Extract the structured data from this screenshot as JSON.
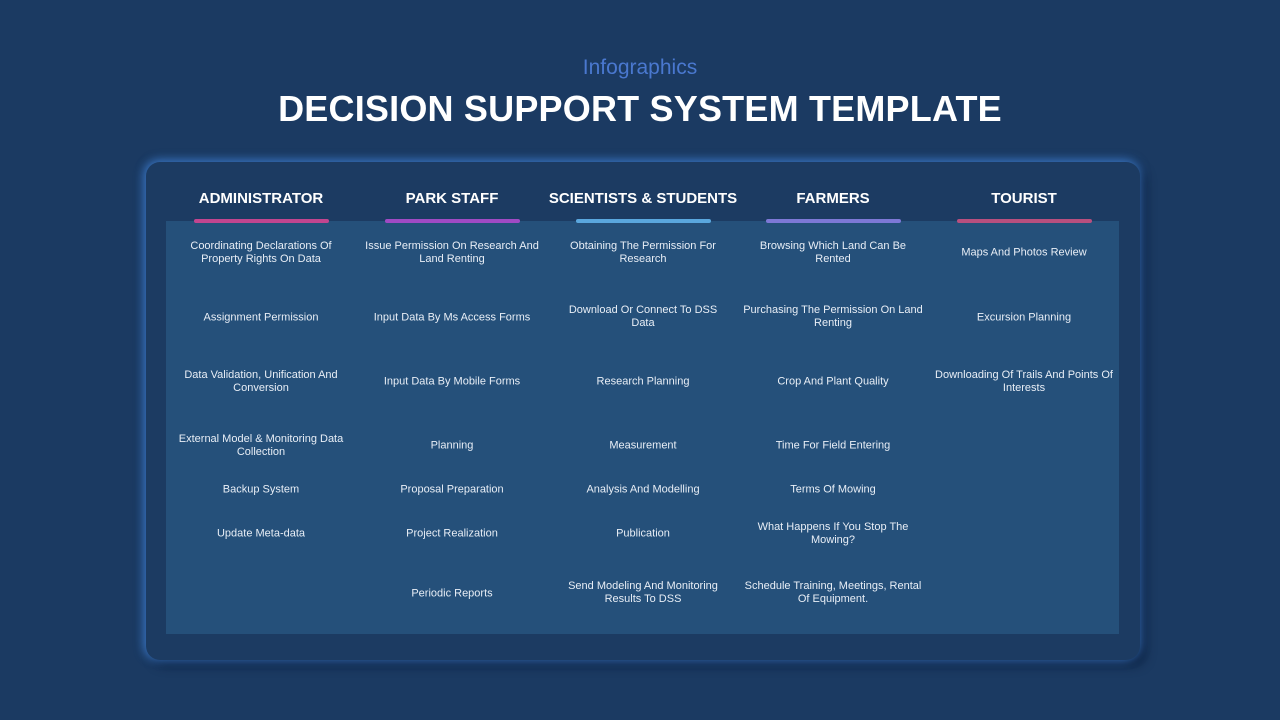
{
  "header": {
    "subtitle": "Infographics",
    "title": "DECISION SUPPORT SYSTEM TEMPLATE"
  },
  "columns": [
    {
      "title": "ADMINISTRATOR",
      "accent": "#c2458f",
      "items": [
        "Coordinating Declarations Of Property Rights On Data",
        "Assignment Permission",
        "Data Validation, Unification And Conversion",
        "External Model & Monitoring Data Collection",
        "Backup System",
        "Update Meta-data"
      ]
    },
    {
      "title": "PARK STAFF",
      "accent": "#a04ac4",
      "items": [
        "Issue Permission On Research And Land Renting",
        "Input Data By Ms Access Forms",
        "Input Data By Mobile Forms",
        "Planning",
        "Proposal Preparation",
        "Project Realization",
        "Periodic Reports"
      ]
    },
    {
      "title": "SCIENTISTS & STUDENTS",
      "accent": "#5aa7de",
      "items": [
        "Obtaining The Permission For Research",
        "Download Or Connect To DSS Data",
        "Research Planning",
        "Measurement",
        "Analysis And Modelling",
        "Publication",
        "Send Modeling And Monitoring Results To DSS"
      ]
    },
    {
      "title": "FARMERS",
      "accent": "#7d78d6",
      "items": [
        "Browsing Which Land Can Be Rented",
        "Purchasing The Permission On Land Renting",
        "Crop And Plant Quality",
        "Time For Field Entering",
        "Terms Of Mowing",
        "What Happens If You Stop The Mowing?",
        "Schedule Training, Meetings, Rental Of Equipment."
      ]
    },
    {
      "title": "TOURIST",
      "accent": "#b84f7e",
      "items": [
        "Maps And Photos Review",
        "Excursion Planning",
        "Downloading Of Trails And Points Of Interests"
      ]
    }
  ]
}
